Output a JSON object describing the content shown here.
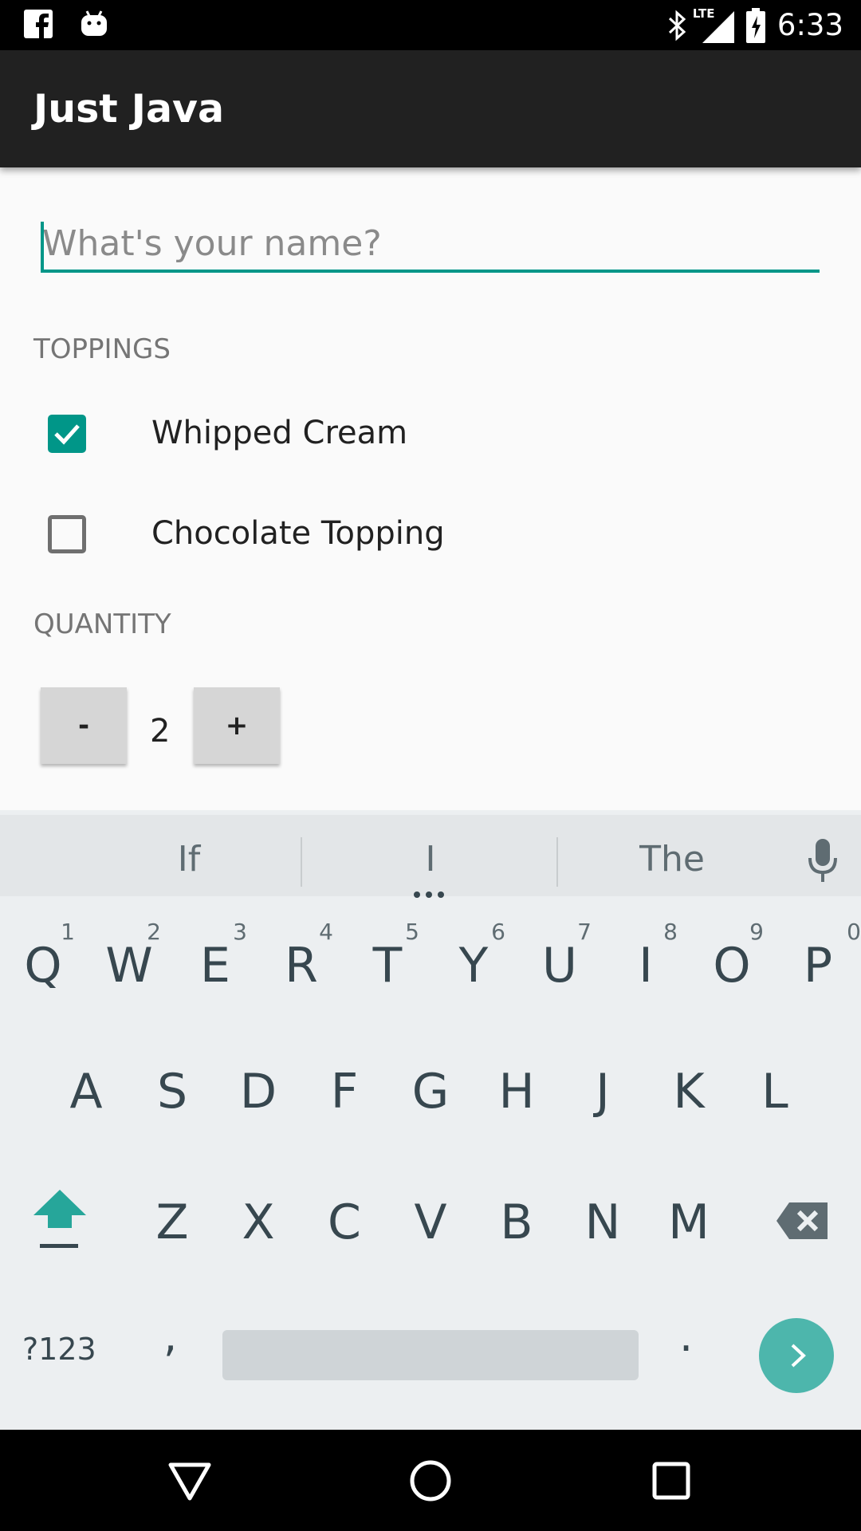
{
  "status_bar": {
    "time": "6:33",
    "network_label": "LTE",
    "icons": [
      "facebook-icon",
      "android-icon",
      "bluetooth-icon",
      "lte-signal-icon",
      "battery-icon"
    ]
  },
  "app_bar": {
    "title": "Just Java"
  },
  "form": {
    "name_field": {
      "value": "",
      "placeholder": "What's your name?"
    },
    "toppings_label": "TOPPINGS",
    "toppings": [
      {
        "label": "Whipped Cream",
        "checked": true
      },
      {
        "label": "Chocolate Topping",
        "checked": false
      }
    ],
    "quantity_label": "QUANTITY",
    "quantity": {
      "decrement_label": "-",
      "value": "2",
      "increment_label": "+"
    }
  },
  "keyboard": {
    "suggestions": [
      "If",
      "I",
      "The"
    ],
    "rows": [
      [
        {
          "key": "Q",
          "hint": "1"
        },
        {
          "key": "W",
          "hint": "2"
        },
        {
          "key": "E",
          "hint": "3"
        },
        {
          "key": "R",
          "hint": "4"
        },
        {
          "key": "T",
          "hint": "5"
        },
        {
          "key": "Y",
          "hint": "6"
        },
        {
          "key": "U",
          "hint": "7"
        },
        {
          "key": "I",
          "hint": "8"
        },
        {
          "key": "O",
          "hint": "9"
        },
        {
          "key": "P",
          "hint": "0"
        }
      ],
      [
        {
          "key": "A"
        },
        {
          "key": "S"
        },
        {
          "key": "D"
        },
        {
          "key": "F"
        },
        {
          "key": "G"
        },
        {
          "key": "H"
        },
        {
          "key": "J"
        },
        {
          "key": "K"
        },
        {
          "key": "L"
        }
      ],
      [
        {
          "key": "Z"
        },
        {
          "key": "X"
        },
        {
          "key": "C"
        },
        {
          "key": "V"
        },
        {
          "key": "B"
        },
        {
          "key": "N"
        },
        {
          "key": "M"
        }
      ]
    ],
    "symbols_label": "?123",
    "comma_label": ",",
    "period_label": ".",
    "accent_color": "#4db6ac"
  },
  "colors": {
    "accent": "#009688",
    "app_bar": "#212121",
    "background": "#fafafa",
    "keyboard": "#eceff1"
  }
}
